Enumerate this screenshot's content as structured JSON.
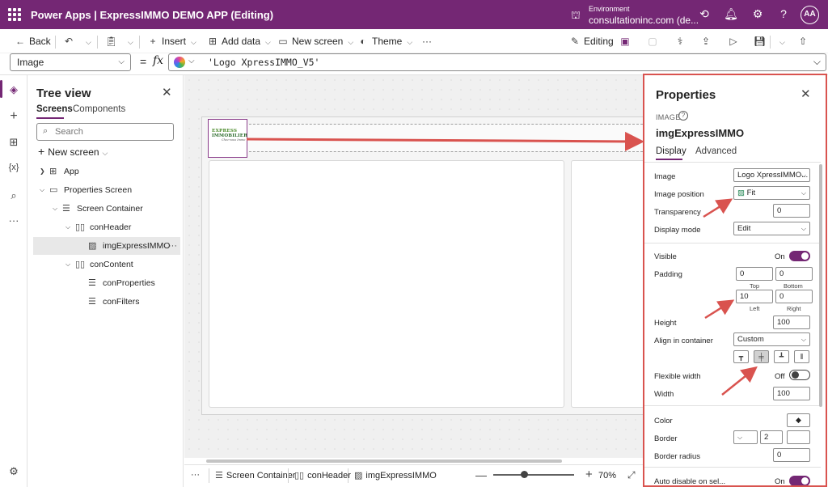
{
  "titlebar": {
    "app_title": "Power Apps  |  ExpressIMMO DEMO APP (Editing)",
    "env_label": "Environment",
    "env_value": "consultationinc.com (de...",
    "avatar_initials": "AA",
    "bg_color": "#742774"
  },
  "commandbar": {
    "back": "Back",
    "insert": "Insert",
    "add_data": "Add data",
    "new_screen": "New screen",
    "theme": "Theme",
    "more": "···",
    "editing": "Editing"
  },
  "formulabar": {
    "property": "Image",
    "eq": "=",
    "fx": "fx",
    "formula": "'Logo XpressIMMO_V5'"
  },
  "tree": {
    "title": "Tree view",
    "tabs": [
      "Screens",
      "Components"
    ],
    "search_placeholder": "Search",
    "new_screen": "New screen",
    "items": [
      {
        "label": "App"
      },
      {
        "label": "Properties Screen"
      },
      {
        "label": "Screen Container"
      },
      {
        "label": "conHeader"
      },
      {
        "label": "imgExpressIMMO"
      },
      {
        "label": "conContent"
      },
      {
        "label": "conProperties"
      },
      {
        "label": "conFilters"
      }
    ]
  },
  "canvas": {
    "logo_line1": "EXPRESS",
    "logo_line2": "IMMOBILIER",
    "logo_line3": "Chez-vous Immo"
  },
  "statusbar": {
    "crumbs": [
      "Screen Container",
      "conHeader",
      "imgExpressIMMO"
    ],
    "zoom": "70%",
    "zoom_level_percent": 70
  },
  "properties": {
    "title": "Properties",
    "control_type": "IMAGE",
    "control_name": "imgExpressIMMO",
    "tabs": [
      "Display",
      "Advanced"
    ],
    "image_label": "Image",
    "image_value": "Logo XpressIMMO...",
    "image_position_label": "Image position",
    "image_position_value": "Fit",
    "transparency_label": "Transparency",
    "transparency_value": "0",
    "display_mode_label": "Display mode",
    "display_mode_value": "Edit",
    "visible_label": "Visible",
    "visible_state": "On",
    "padding_label": "Padding",
    "padding_top": "0",
    "padding_bottom": "0",
    "padding_left": "10",
    "padding_right": "0",
    "top_label": "Top",
    "bottom_label": "Bottom",
    "left_label": "Left",
    "right_label": "Right",
    "height_label": "Height",
    "height_value": "100",
    "align_label": "Align in container",
    "align_value": "Custom",
    "flex_width_label": "Flexible width",
    "flex_width_state": "Off",
    "width_label": "Width",
    "width_value": "100",
    "color_label": "Color",
    "border_label": "Border",
    "border_value": "2",
    "border_radius_label": "Border radius",
    "border_radius_value": "0",
    "auto_disable_label": "Auto disable on sel...",
    "auto_disable_state": "On"
  },
  "colors": {
    "accent": "#742774",
    "annotation": "#d9534f"
  }
}
